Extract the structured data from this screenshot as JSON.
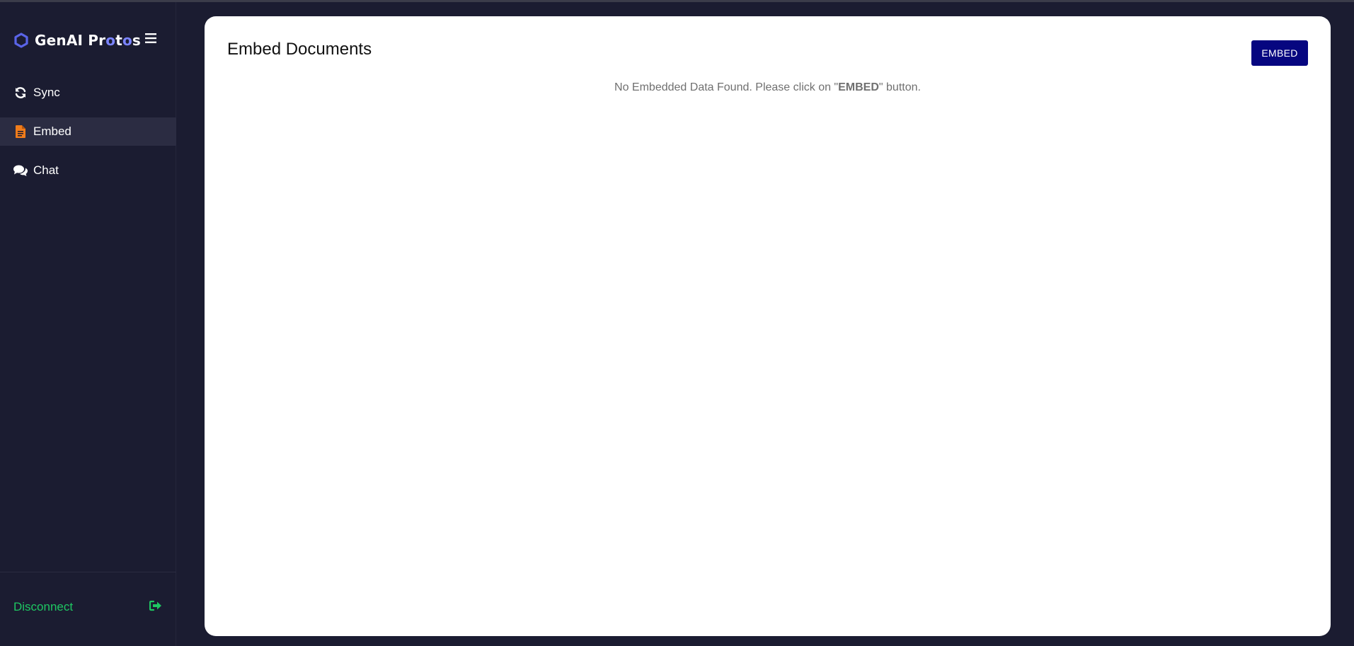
{
  "brand": {
    "name_prefix": "GenAI Pr",
    "name_o1": "o",
    "name_mid": "t",
    "name_o2": "o",
    "name_suffix": "s",
    "accent_color": "#7b84ff"
  },
  "sidebar": {
    "menu_icon": "hamburger-icon",
    "items": [
      {
        "label": "Sync",
        "icon": "sync-icon",
        "active": false
      },
      {
        "label": "Embed",
        "icon": "file-icon",
        "active": true,
        "icon_color": "#f07c1b"
      },
      {
        "label": "Chat",
        "icon": "chat-icon",
        "active": false
      }
    ],
    "footer": {
      "label": "Disconnect",
      "icon": "sign-out-icon",
      "color": "#1ec762"
    }
  },
  "main": {
    "title": "Embed Documents",
    "embed_button_label": "EMBED",
    "button_color": "#060680",
    "empty_message": {
      "before": "No Embedded Data Found. Please click on \"",
      "bold": "EMBED",
      "after": "\" button."
    }
  }
}
